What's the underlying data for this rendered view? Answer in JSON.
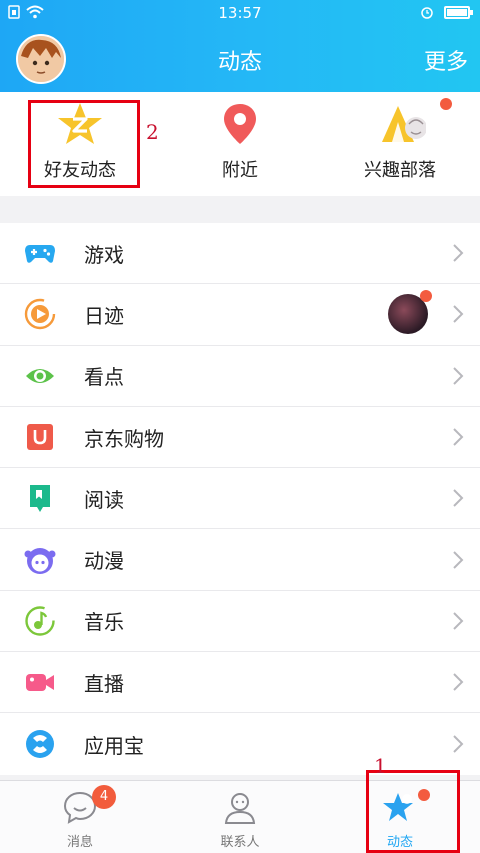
{
  "status_bar": {
    "time": "13:57"
  },
  "header": {
    "title": "动态",
    "more_label": "更多"
  },
  "quick_entries": [
    {
      "label": "好友动态",
      "icon": "friend-feed-star-icon"
    },
    {
      "label": "附近",
      "icon": "location-pin-icon"
    },
    {
      "label": "兴趣部落",
      "icon": "tribe-icon"
    }
  ],
  "list": [
    {
      "label": "游戏",
      "icon": "gamepad-icon"
    },
    {
      "label": "日迹",
      "icon": "daily-trace-icon"
    },
    {
      "label": "看点",
      "icon": "eye-icon"
    },
    {
      "label": "京东购物",
      "icon": "jd-shopping-icon"
    },
    {
      "label": "阅读",
      "icon": "bookmark-icon"
    },
    {
      "label": "动漫",
      "icon": "anime-icon"
    },
    {
      "label": "音乐",
      "icon": "music-note-icon"
    },
    {
      "label": "直播",
      "icon": "live-camera-icon"
    },
    {
      "label": "应用宝",
      "icon": "app-store-icon"
    }
  ],
  "tabs": [
    {
      "label": "消息",
      "badge": "4"
    },
    {
      "label": "联系人"
    },
    {
      "label": "动态"
    }
  ],
  "annotations": {
    "step1": "1",
    "step2": "2"
  },
  "colors": {
    "header": "#1ea7f5",
    "accent": "#1fa6f2",
    "badge": "#f25c3c",
    "highlight": "#e60012"
  }
}
